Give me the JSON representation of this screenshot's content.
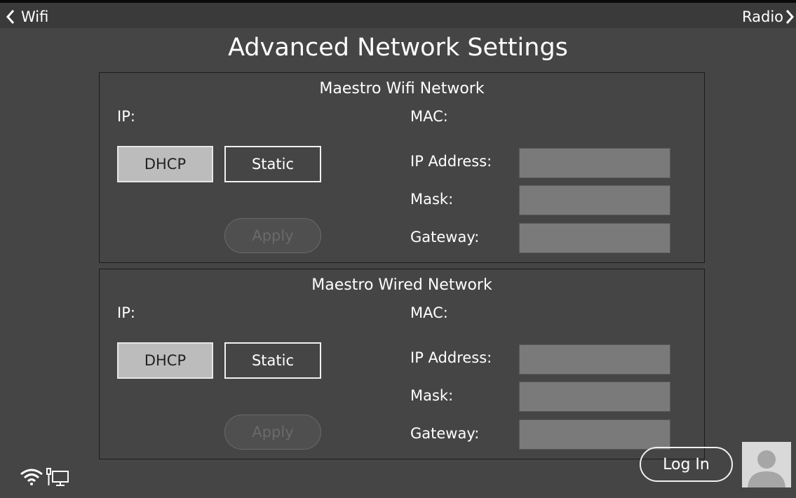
{
  "nav": {
    "back_label": "Wifi",
    "next_label": "Radio"
  },
  "page": {
    "title": "Advanced Network Settings"
  },
  "wifi_panel": {
    "title": "Maestro Wifi Network",
    "ip_label": "IP:",
    "mac_label": "MAC:",
    "dhcp_label": "DHCP",
    "static_label": "Static",
    "apply_label": "Apply",
    "ip_address_label": "IP Address:",
    "mask_label": "Mask:",
    "gateway_label": "Gateway:",
    "ip_address_value": "",
    "mask_value": "",
    "gateway_value": ""
  },
  "wired_panel": {
    "title": "Maestro Wired Network",
    "ip_label": "IP:",
    "mac_label": "MAC:",
    "dhcp_label": "DHCP",
    "static_label": "Static",
    "apply_label": "Apply",
    "ip_address_label": "IP Address:",
    "mask_label": "Mask:",
    "gateway_label": "Gateway:",
    "ip_address_value": "",
    "mask_value": "",
    "gateway_value": ""
  },
  "footer": {
    "login_label": "Log In"
  },
  "icons": {
    "back": "chevron-left-icon",
    "next": "chevron-right-icon",
    "wifi": "wifi-icon",
    "wired": "ethernet-monitor-icon",
    "avatar": "user-avatar-icon"
  },
  "colors": {
    "background": "#454545",
    "topbar": "#3a3a3a",
    "dhcp_selected": "#bcbcbc",
    "field": "#7a7a7a",
    "disabled_text": "#6a6a6a"
  }
}
